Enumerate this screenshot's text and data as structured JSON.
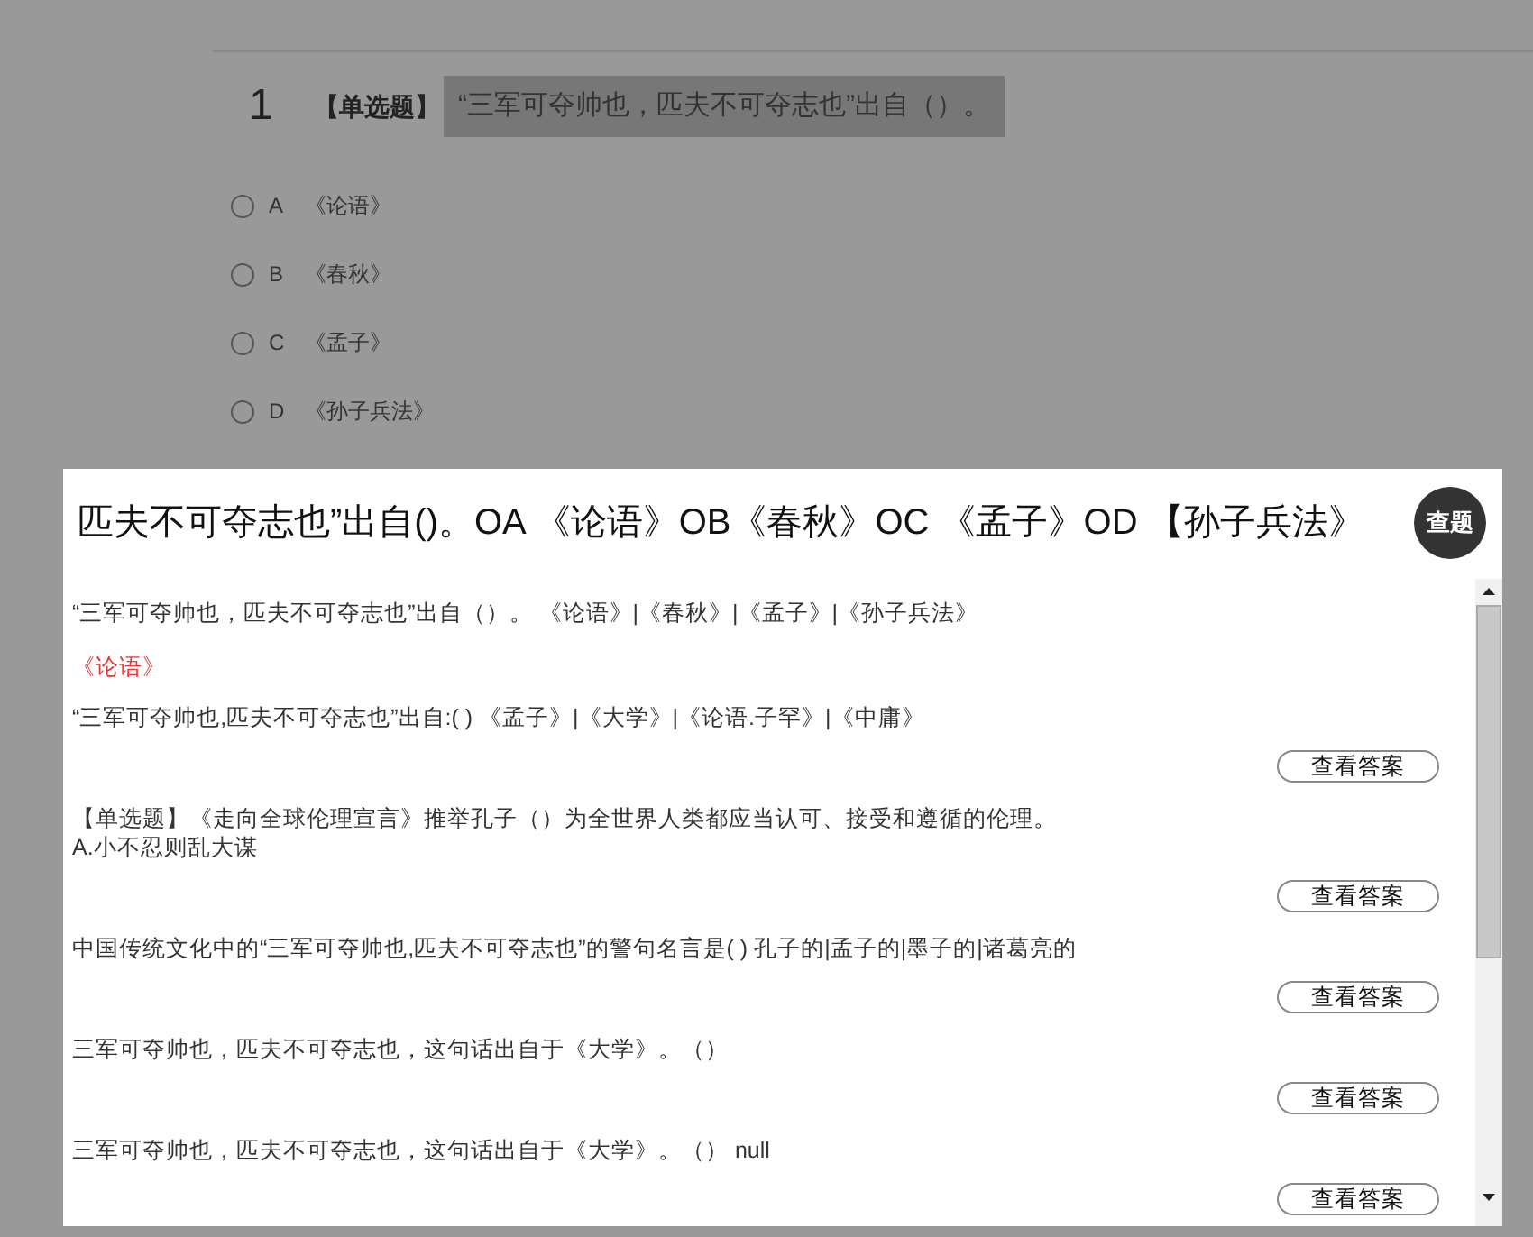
{
  "question": {
    "number": "1",
    "type_tag": "【单选题】",
    "stem": "“三军可夺帅也，匹夫不可夺志也”出自（）。",
    "options": [
      {
        "letter": "A",
        "text": "《论语》",
        "selected": false
      },
      {
        "letter": "B",
        "text": "《春秋》",
        "selected": false
      },
      {
        "letter": "C",
        "text": "《孟子》",
        "selected": false
      },
      {
        "letter": "D",
        "text": "《孙子兵法》",
        "selected": false
      }
    ]
  },
  "popup": {
    "query": "匹夫不可夺志也”出自()。OA 《论语》OB《春秋》OC 《孟子》OD 【孙子兵法》",
    "search_button": "查题",
    "results": [
      {
        "lines": [
          "“三军可夺帅也，匹夫不可夺志也”出自（）。 《论语》|《春秋》|《孟子》|《孙子兵法》"
        ],
        "answer": "《论语》"
      },
      {
        "lines": [
          "“三军可夺帅也,匹夫不可夺志也”出自:( ) 《孟子》|《大学》|《论语.子罕》|《中庸》"
        ],
        "button": "查看答案"
      },
      {
        "lines": [
          "【单选题】《走向全球伦理宣言》推举孔子（）为全世界人类都应当认可、接受和遵循的伦理。",
          "A.小不忍则乱大谋"
        ],
        "button": "查看答案"
      },
      {
        "lines": [
          "中国传统文化中的“三军可夺帅也,匹夫不可夺志也”的警句名言是( ) 孔子的|孟子的|墨子的|诸葛亮的"
        ],
        "button": "查看答案"
      },
      {
        "lines": [
          "三军可夺帅也，匹夫不可夺志也，这句话出自于《大学》。（）"
        ],
        "button": "查看答案"
      },
      {
        "lines": [
          "三军可夺帅也，匹夫不可夺志也，这句话出自于《大学》。（） null"
        ],
        "button": "查看答案"
      }
    ]
  }
}
